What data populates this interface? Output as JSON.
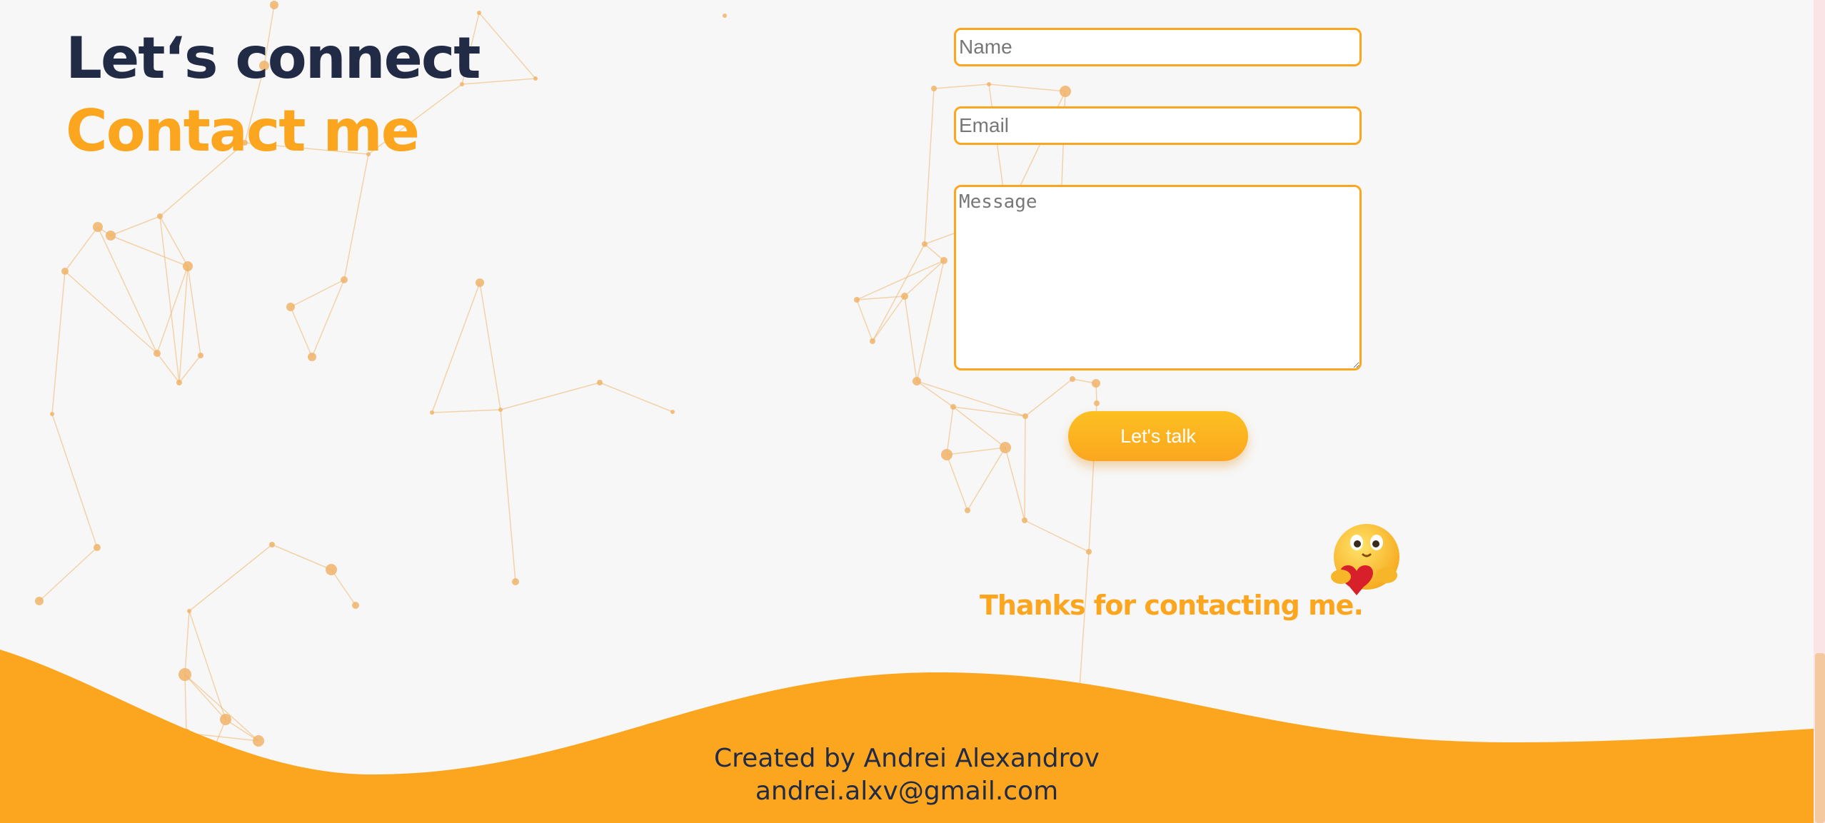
{
  "colors": {
    "accent": "#fca620",
    "navy": "#222b45",
    "background": "#f7f7f7",
    "network": "#f0b46a"
  },
  "header": {
    "title": "Let‘s connect",
    "subtitle": "Contact me"
  },
  "form": {
    "name_placeholder": "Name",
    "email_placeholder": "Email",
    "message_placeholder": "Message",
    "submit_label": "Let's talk"
  },
  "thanks": {
    "text": "Thanks for contacting me.",
    "emoji_icon": "hugging-heart-emoji-icon"
  },
  "footer": {
    "credit": "Created by Andrei Alexandrov",
    "email": "andrei.alxv@gmail.com"
  }
}
